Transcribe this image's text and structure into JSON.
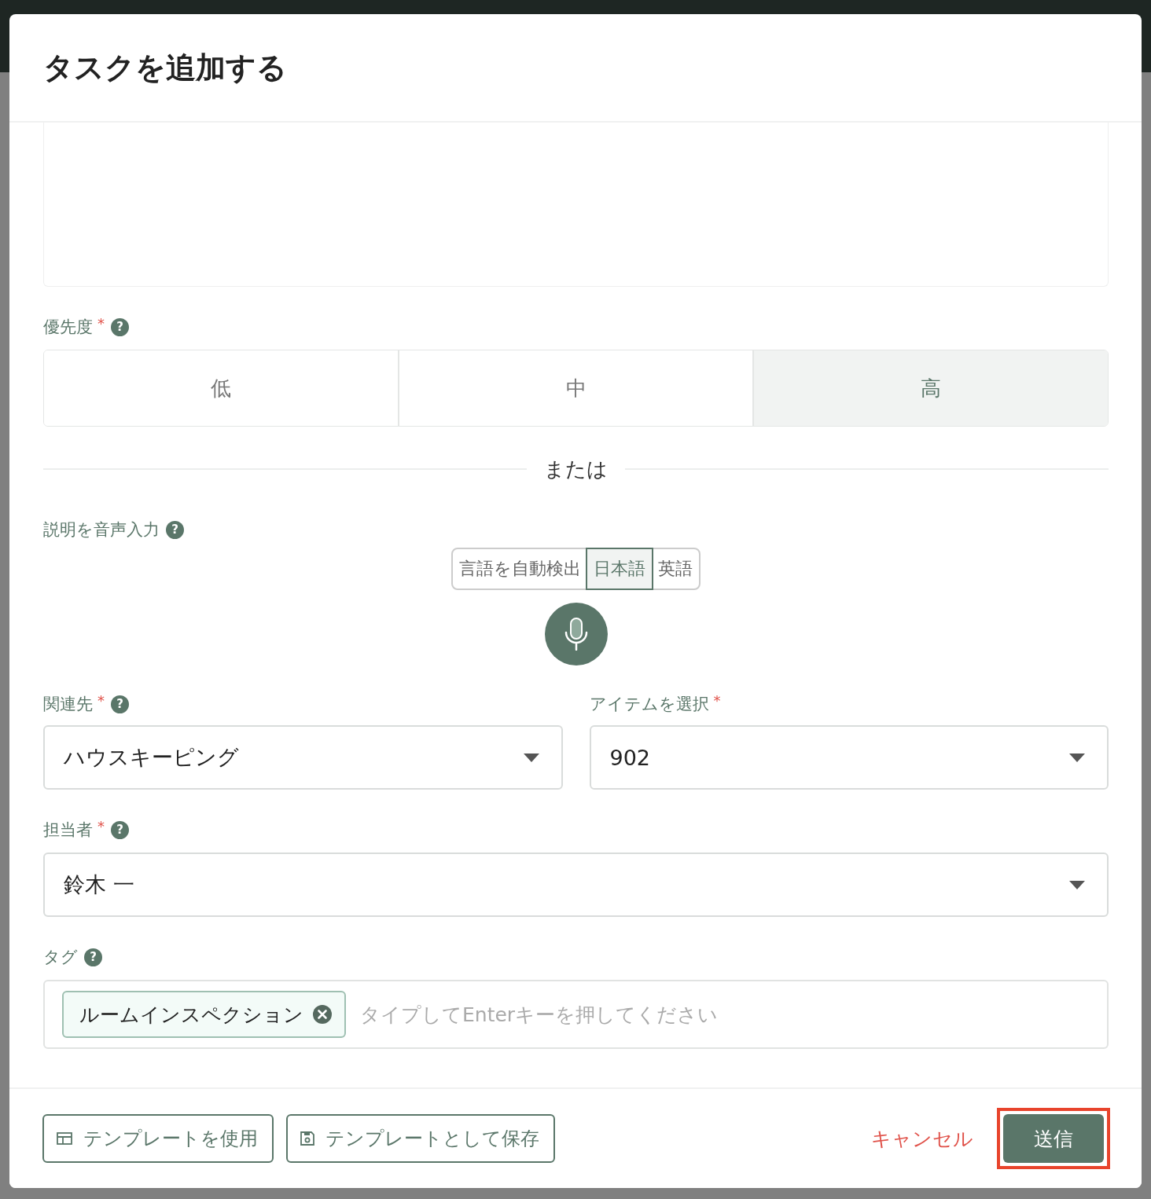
{
  "dialog": {
    "title": "タスクを追加する"
  },
  "priority": {
    "label": "優先度",
    "required_mark": "*",
    "help": "?",
    "options": [
      {
        "label": "低",
        "selected": false
      },
      {
        "label": "中",
        "selected": false
      },
      {
        "label": "高",
        "selected": true
      }
    ]
  },
  "divider_text": "または",
  "voice_input": {
    "label": "説明を音声入力",
    "help": "?",
    "languages": [
      {
        "label": "言語を自動検出",
        "selected": false
      },
      {
        "label": "日本語",
        "selected": true
      },
      {
        "label": "英語",
        "selected": false
      }
    ]
  },
  "related": {
    "label": "関連先",
    "required_mark": "*",
    "help": "?",
    "value": "ハウスキーピング"
  },
  "item": {
    "label": "アイテムを選択",
    "required_mark": "*",
    "value": "902"
  },
  "assignee": {
    "label": "担当者",
    "required_mark": "*",
    "help": "?",
    "value": "鈴木 一"
  },
  "tags": {
    "label": "タグ",
    "help": "?",
    "chips": [
      "ルームインスペクション"
    ],
    "placeholder": "タイプしてEnterキーを押してください"
  },
  "footer": {
    "use_template": "テンプレートを使用",
    "save_template": "テンプレートとして保存",
    "cancel": "キャンセル",
    "submit": "送信",
    "submit_highlighted": true
  }
}
